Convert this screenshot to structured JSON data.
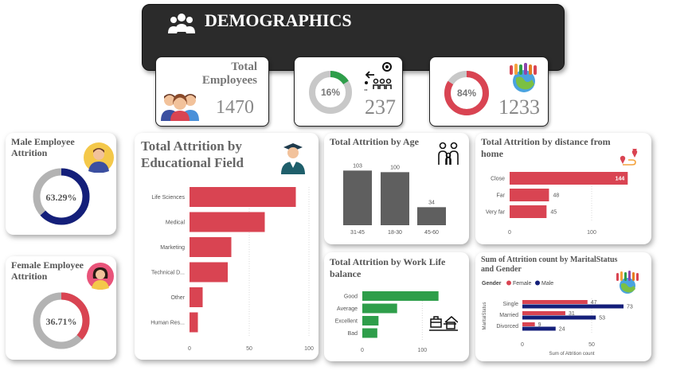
{
  "header": {
    "title": "DEMOGRAPHICS"
  },
  "kpis": {
    "total": {
      "label_line1": "Total",
      "label_line2": "Employees",
      "value": "1470"
    },
    "attrition": {
      "percent_label": "16%",
      "percent": 16,
      "value": "237",
      "color": "#2e9e4a"
    },
    "active": {
      "percent_label": "84%",
      "percent": 84,
      "value": "1233",
      "color": "#d94452"
    }
  },
  "cards": {
    "male": {
      "title_line1": "Male Employee",
      "title_line2": "Attrition",
      "percent_label": "63.29%",
      "percent": 63.29,
      "color": "#141f7a"
    },
    "female": {
      "title_line1": "Female Employee",
      "title_line2": "Attrition",
      "percent_label": "36.71%",
      "percent": 36.71,
      "color": "#d94452"
    },
    "edu": {
      "title_line1": "Total Attrition by",
      "title_line2": "Educational Field"
    },
    "age": {
      "title": "Total Attrition by Age"
    },
    "distance": {
      "title_line1": "Total Attrition by distance from",
      "title_line2": "home"
    },
    "wlb": {
      "title_line1": "Total Attrition by Work Life",
      "title_line2": "balance"
    },
    "marital": {
      "title_line1": "Sum of Attrition count by MaritalStatus",
      "title_line2": "and Gender",
      "legend_title": "Gender"
    }
  },
  "colors": {
    "red": "#d94452",
    "grey": "#5f5f5f",
    "green": "#2e9e4a",
    "navy": "#141f7a",
    "header": "#2b2b2b"
  },
  "chart_data": [
    {
      "id": "edu",
      "type": "bar",
      "orientation": "horizontal",
      "categories": [
        "Life Sciences",
        "Medical",
        "Marketing",
        "Technical D...",
        "Other",
        "Human Res..."
      ],
      "values": [
        89,
        63,
        35,
        32,
        11,
        7
      ],
      "xlim": [
        0,
        100
      ],
      "xticks": [
        0,
        50,
        100
      ],
      "xtick_labels": [
        "0",
        "50",
        "100"
      ]
    },
    {
      "id": "age",
      "type": "bar",
      "orientation": "vertical",
      "categories": [
        "31-45",
        "18-30",
        "45-60"
      ],
      "values": [
        103,
        100,
        34
      ],
      "data_labels": [
        "103",
        "100",
        "34"
      ],
      "ylim": [
        0,
        120
      ]
    },
    {
      "id": "distance",
      "type": "bar",
      "orientation": "horizontal",
      "categories": [
        "Close",
        "Far",
        "Very far"
      ],
      "values": [
        144,
        48,
        45
      ],
      "data_labels": [
        "144",
        "48",
        "45"
      ],
      "xlim": [
        0,
        200
      ],
      "xticks": [
        0,
        100
      ],
      "xtick_labels": [
        "0",
        "100"
      ]
    },
    {
      "id": "wlb",
      "type": "bar",
      "orientation": "horizontal",
      "categories": [
        "Good",
        "Average",
        "Excellent",
        "Bad"
      ],
      "values": [
        127,
        58,
        27,
        25
      ],
      "xlim": [
        0,
        150
      ],
      "xticks": [
        0,
        100
      ],
      "xtick_labels": [
        "0",
        "100"
      ]
    },
    {
      "id": "marital",
      "type": "bar",
      "orientation": "horizontal",
      "categories": [
        "Single",
        "Married",
        "Divorced"
      ],
      "series": [
        {
          "name": "Female",
          "values": [
            47,
            31,
            9
          ],
          "color": "#d94452"
        },
        {
          "name": "Male",
          "values": [
            73,
            53,
            24
          ],
          "color": "#141f7a"
        }
      ],
      "xlim": [
        0,
        100
      ],
      "xticks": [
        0,
        50
      ],
      "xtick_labels": [
        "0",
        "50"
      ],
      "xlabel": "Sum of Attrition count",
      "ylabel": "MaritalStatus",
      "legend": "top-left"
    }
  ]
}
